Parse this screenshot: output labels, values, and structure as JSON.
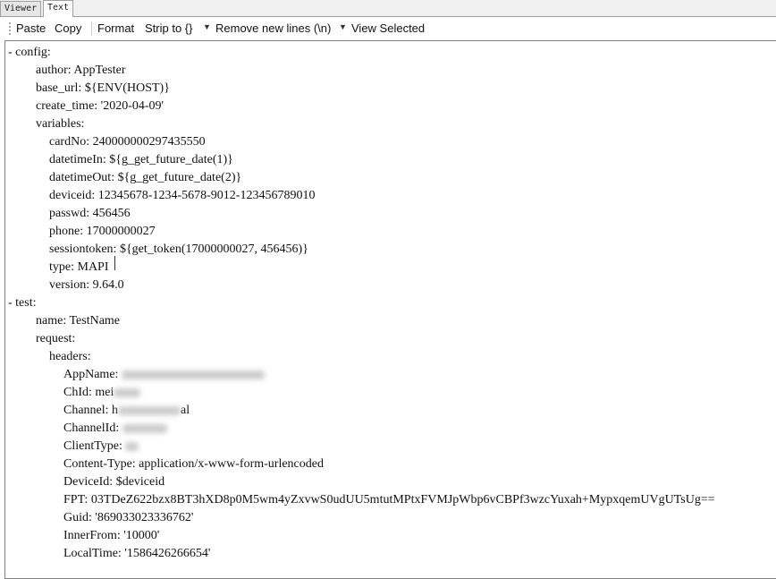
{
  "tabs": [
    {
      "label": "Viewer",
      "active": false
    },
    {
      "label": "Text",
      "active": true
    }
  ],
  "toolbar": {
    "paste": "Paste",
    "copy": "Copy",
    "format": "Format",
    "strip": "Strip to {}",
    "remove_newlines": "Remove new lines (\\n)",
    "view_selected": "View Selected"
  },
  "lines": [
    {
      "indent": 0,
      "text": "- config:"
    },
    {
      "indent": 1,
      "text": "author: AppTester"
    },
    {
      "indent": 1,
      "text": "base_url: ${ENV(HOST)}"
    },
    {
      "indent": 1,
      "text": "create_time: '2020-04-09'"
    },
    {
      "indent": 1,
      "text": "variables:"
    },
    {
      "indent": 2,
      "text": "cardNo: 240000000297435550"
    },
    {
      "indent": 2,
      "text": "datetimeIn: ${g_get_future_date(1)}"
    },
    {
      "indent": 2,
      "text": "datetimeOut: ${g_get_future_date(2)}"
    },
    {
      "indent": 2,
      "text": "deviceid: 12345678-1234-5678-9012-123456789010"
    },
    {
      "indent": 2,
      "text": "passwd: 456456"
    },
    {
      "indent": 2,
      "text": "phone: 17000000027"
    },
    {
      "indent": 2,
      "text": "sessiontoken: ${get_token(17000000027, 456456)}"
    },
    {
      "indent": 2,
      "text": "type: MAPI"
    },
    {
      "indent": 2,
      "text": "version: 9.64.0"
    },
    {
      "indent": 0,
      "text": "- test:"
    },
    {
      "indent": 1,
      "text": "name: TestName"
    },
    {
      "indent": 1,
      "text": "request:"
    },
    {
      "indent": 2,
      "text": "headers:"
    },
    {
      "indent": 3,
      "text": "AppName: ",
      "blur": 160
    },
    {
      "indent": 3,
      "text": "ChId: mei",
      "blur": 30
    },
    {
      "indent": 3,
      "text": "Channel: h",
      "blur": 70,
      "after": "al"
    },
    {
      "indent": 3,
      "text": "ChannelId: ",
      "blur": 50
    },
    {
      "indent": 3,
      "text": "ClientType: ",
      "blur": 15
    },
    {
      "indent": 3,
      "text": "Content-Type: application/x-www-form-urlencoded"
    },
    {
      "indent": 3,
      "text": "DeviceId: $deviceid"
    },
    {
      "indent": 3,
      "text": "FPT: 03TDeZ622bzx8BT3hXD8p0M5wm4yZxvwS0udUU5mtutMPtxFVMJpWbp6vCBPf3wzcYuxah+MypxqemUVgUTsUg=="
    },
    {
      "indent": 3,
      "text": "Guid: '869033023336762'"
    },
    {
      "indent": 3,
      "text": "InnerFrom: '10000'"
    },
    {
      "indent": 3,
      "text": "LocalTime: '1586426266654'"
    }
  ]
}
